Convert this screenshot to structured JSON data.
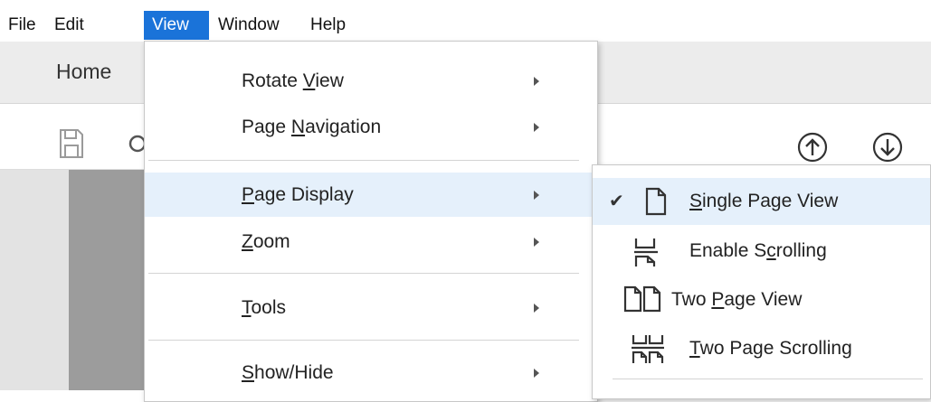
{
  "menubar": {
    "items": [
      {
        "label": "File"
      },
      {
        "label": "Edit"
      },
      {
        "label": "View"
      },
      {
        "label": "Window"
      },
      {
        "label": "Help"
      }
    ]
  },
  "tabs": {
    "home_label": "Home"
  },
  "view_menu": {
    "items": [
      {
        "label_pre": "Rotate ",
        "mnemonic": "V",
        "label_post": "iew",
        "has_submenu": true
      },
      {
        "label_pre": "Page ",
        "mnemonic": "N",
        "label_post": "avigation",
        "has_submenu": true
      },
      {
        "label_pre": "",
        "mnemonic": "P",
        "label_post": "age Display",
        "has_submenu": true
      },
      {
        "label_pre": "",
        "mnemonic": "Z",
        "label_post": "oom",
        "has_submenu": true
      },
      {
        "label_pre": "",
        "mnemonic": "T",
        "label_post": "ools",
        "has_submenu": true
      },
      {
        "label_pre": "",
        "mnemonic": "S",
        "label_post": "how/Hide",
        "has_submenu": true
      }
    ]
  },
  "page_display_menu": {
    "items": [
      {
        "label_pre": "",
        "mnemonic": "S",
        "label_post": "ingle Page View",
        "checked": true,
        "icon": "single-page-icon"
      },
      {
        "label_pre": "Enable S",
        "mnemonic": "c",
        "label_post": "rolling",
        "checked": false,
        "icon": "scrolling-icon"
      },
      {
        "label_pre": "Two ",
        "mnemonic": "P",
        "label_post": "age View",
        "checked": false,
        "icon": "two-page-icon"
      },
      {
        "label_pre": "",
        "mnemonic": "T",
        "label_post": "wo Page Scrolling",
        "checked": false,
        "icon": "two-page-scrolling-icon"
      }
    ]
  },
  "colors": {
    "menubar_active": "#1a73d9",
    "menu_highlight": "#e5f0fb",
    "document_background": "#9c9c9c"
  }
}
